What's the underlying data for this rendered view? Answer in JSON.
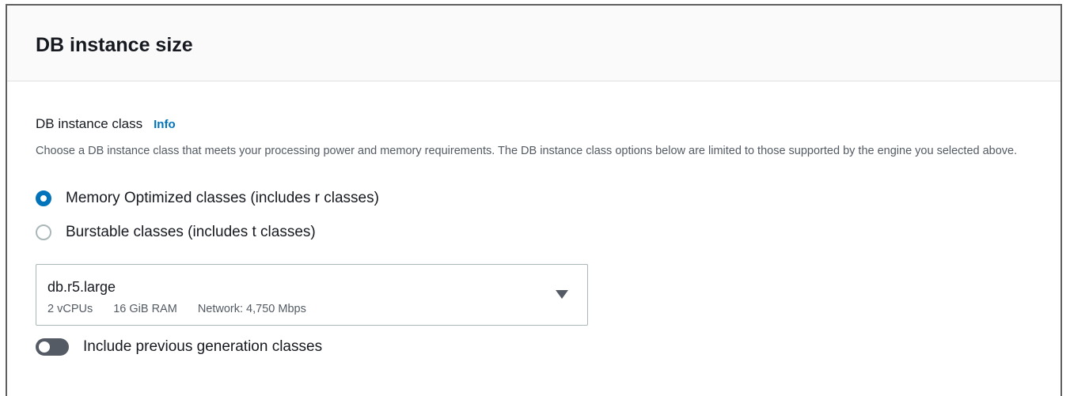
{
  "panel": {
    "title": "DB instance size"
  },
  "instance_class": {
    "label": "DB instance class",
    "info_link": "Info",
    "description": "Choose a DB instance class that meets your processing power and memory requirements. The DB instance class options below are limited to those supported by the engine you selected above.",
    "options": [
      {
        "label": "Memory Optimized classes (includes r classes)",
        "selected": true
      },
      {
        "label": "Burstable classes (includes t classes)",
        "selected": false
      }
    ]
  },
  "select": {
    "value": "db.r5.large",
    "vcpus": "2 vCPUs",
    "ram": "16 GiB RAM",
    "network": "Network: 4,750 Mbps",
    "icon": "caret-down-icon"
  },
  "toggle": {
    "label": "Include previous generation classes",
    "enabled": false
  },
  "colors": {
    "accent": "#0073bb",
    "text": "#16191f",
    "secondary_text": "#545b64",
    "header_bg": "#fafafa"
  }
}
